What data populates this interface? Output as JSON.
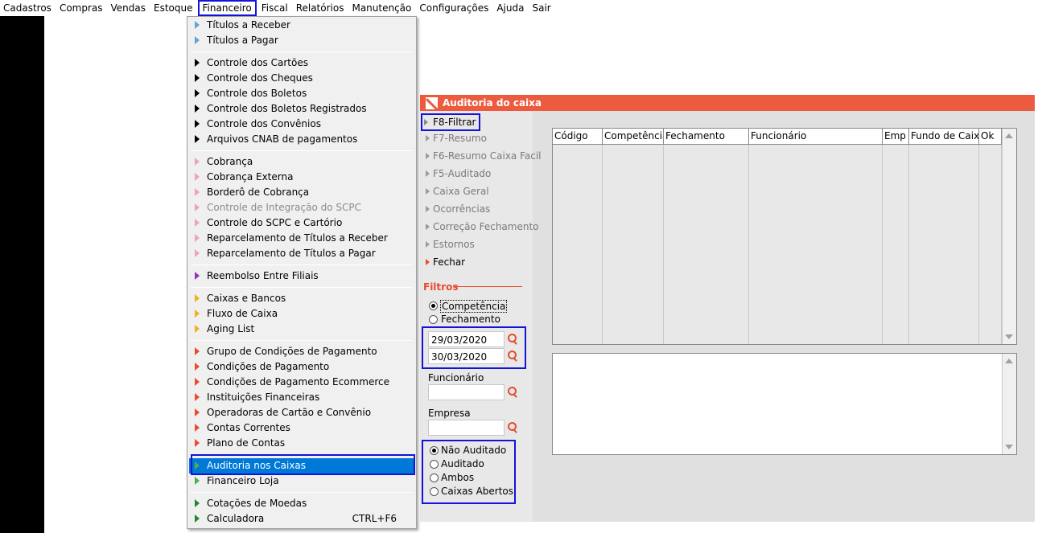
{
  "menubar": {
    "items": [
      "Cadastros",
      "Compras",
      "Vendas",
      "Estoque",
      "Financeiro",
      "Fiscal",
      "Relatórios",
      "Manutenção",
      "Configurações",
      "Ajuda",
      "Sair"
    ]
  },
  "financeiro_menu": {
    "items": [
      {
        "label": "Títulos a Receber",
        "color": "#5aa6db"
      },
      {
        "label": "Títulos a Pagar",
        "color": "#5aa6db"
      },
      {
        "label": "Controle dos Cartões",
        "color": "#000000"
      },
      {
        "label": "Controle dos Cheques",
        "color": "#000000"
      },
      {
        "label": "Controle dos Boletos",
        "color": "#000000"
      },
      {
        "label": "Controle dos Boletos Registrados",
        "color": "#000000"
      },
      {
        "label": "Controle dos Convênios",
        "color": "#000000"
      },
      {
        "label": "Arquivos CNAB de pagamentos",
        "color": "#000000"
      },
      {
        "label": "Cobrança",
        "color": "#f0a0c8"
      },
      {
        "label": "Cobrança Externa",
        "color": "#f0a0c8"
      },
      {
        "label": "Borderô de Cobrança",
        "color": "#f0a0c8"
      },
      {
        "label": "Controle de Integração do SCPC",
        "color": "#f0a0c8",
        "disabled": true
      },
      {
        "label": "Controle do SCPC e Cartório",
        "color": "#f0a0c8"
      },
      {
        "label": "Reparcelamento de Títulos a Receber",
        "color": "#f0a0c8"
      },
      {
        "label": "Reparcelamento de Títulos a Pagar",
        "color": "#f0a0c8"
      },
      {
        "label": "Reembolso Entre Filiais",
        "color": "#9b2fc4"
      },
      {
        "label": "Caixas e Bancos",
        "color": "#f0b020"
      },
      {
        "label": "Fluxo de Caixa",
        "color": "#f0b020"
      },
      {
        "label": "Aging List",
        "color": "#f0b020"
      },
      {
        "label": "Grupo de Condições de Pagamento",
        "color": "#e84c2e"
      },
      {
        "label": "Condições de Pagamento",
        "color": "#e84c2e"
      },
      {
        "label": "Condições de Pagamento Ecommerce",
        "color": "#e84c2e"
      },
      {
        "label": "Instituições Financeiras",
        "color": "#e84c2e"
      },
      {
        "label": "Operadoras de Cartão e Convênio",
        "color": "#e84c2e"
      },
      {
        "label": "Contas Correntes",
        "color": "#e84c2e"
      },
      {
        "label": "Plano de Contas",
        "color": "#e84c2e"
      },
      {
        "label": "Auditoria nos Caixas",
        "color": "#4caf50",
        "selected": true
      },
      {
        "label": "Financeiro Loja",
        "color": "#4caf50"
      },
      {
        "label": "Cotações de Moedas",
        "color": "#1e8a2e"
      },
      {
        "label": "Calculadora",
        "color": "#1e8a2e",
        "shortcut": "CTRL+F6"
      }
    ]
  },
  "window": {
    "title": "Auditoria do caixa",
    "actions": [
      {
        "label": "F8-Filtrar",
        "enabled": true
      },
      {
        "label": "F7-Resumo",
        "enabled": false
      },
      {
        "label": "F6-Resumo Caixa Facil",
        "enabled": false
      },
      {
        "label": "F5-Auditado",
        "enabled": false
      },
      {
        "label": "Caixa Geral",
        "enabled": false
      },
      {
        "label": "Ocorrências",
        "enabled": false
      },
      {
        "label": "Correção Fechamento",
        "enabled": false
      },
      {
        "label": "Estornos",
        "enabled": false
      },
      {
        "label": "Fechar",
        "enabled": true
      }
    ],
    "filters": {
      "heading": "Filtros",
      "date_type": [
        "Competência",
        "Fechamento"
      ],
      "date_from": "29/03/2020",
      "date_to": "30/03/2020",
      "funcionario_label": "Funcionário",
      "funcionario_value": "",
      "empresa_label": "Empresa",
      "empresa_value": "",
      "status": [
        "Não Auditado",
        "Auditado",
        "Ambos",
        "Caixas Abertos"
      ]
    },
    "grid": {
      "columns": [
        "Código",
        "Competência",
        "Fechamento",
        "Funcionário",
        "Emp",
        "Fundo de Caixa",
        "Ok"
      ]
    }
  }
}
